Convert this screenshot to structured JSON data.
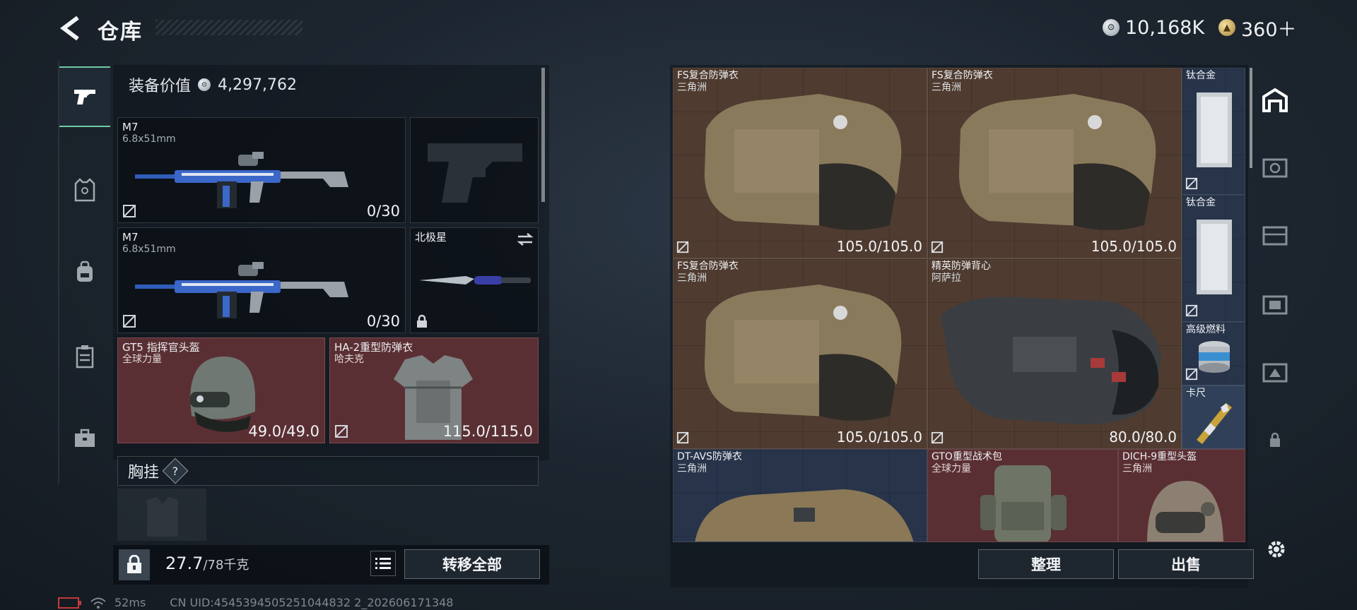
{
  "header": {
    "title": "仓库"
  },
  "currency": {
    "coins": "10,168K",
    "gold": "360＋"
  },
  "loadout": {
    "value_label": "装备价值",
    "value": "4,297,762",
    "slots": [
      {
        "name": "M7",
        "caliber": "6.8x51mm",
        "ammo": "0/30"
      },
      {
        "name": "M7",
        "caliber": "6.8x51mm",
        "ammo": "0/30"
      },
      {
        "name": "北极星"
      },
      {
        "name": "GT5 指挥官头盔",
        "brand": "全球力量",
        "durability": "49.0/49.0"
      },
      {
        "name": "HA-2重型防弹衣",
        "brand": "哈夫克",
        "durability": "115.0/115.0"
      }
    ],
    "chest_rig_label": "胸挂",
    "help": "?"
  },
  "bottom": {
    "weight": "27.7",
    "weight_max": "/78千克",
    "transfer_all": "转移全部",
    "organize": "整理",
    "sell": "出售"
  },
  "status": {
    "ping": "52ms",
    "uid": "CN UID:4545394505251044832 2_202606171348"
  },
  "storage": {
    "items": [
      {
        "name": "FS复合防弹衣",
        "brand": "三角洲",
        "durability": "105.0/105.0"
      },
      {
        "name": "FS复合防弹衣",
        "brand": "三角洲",
        "durability": "105.0/105.0"
      },
      {
        "name": "FS复合防弹衣",
        "brand": "三角洲",
        "durability": "105.0/105.0"
      },
      {
        "name": "精英防弹背心",
        "brand": "阿萨拉",
        "durability": "80.0/80.0"
      },
      {
        "name": "钛合金"
      },
      {
        "name": "钛合金"
      },
      {
        "name": "高级燃料"
      },
      {
        "name": "卡尺"
      },
      {
        "name": "DT-AVS防弹衣",
        "brand": "三角洲"
      },
      {
        "name": "GTO重型战术包",
        "brand": "全球力量"
      },
      {
        "name": "DICH-9重型头盔",
        "brand": "三角洲"
      }
    ]
  },
  "colors": {
    "accent": "#6fcaa5",
    "red_slot": "#5a2f33",
    "brown_cell": "#4f3b30",
    "navy_cell": "#28344a"
  }
}
